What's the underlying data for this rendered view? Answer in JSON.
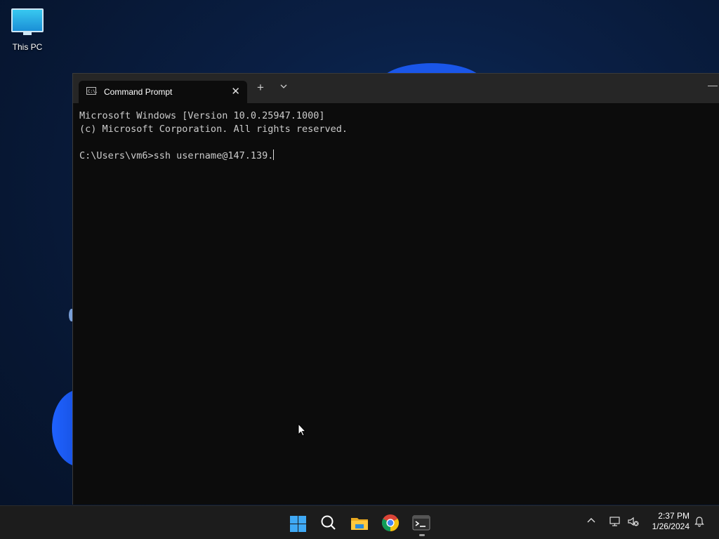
{
  "desktop": {
    "icons": [
      {
        "label": "This PC",
        "icon": "this-pc-icon"
      }
    ]
  },
  "terminal": {
    "tab_title": "Command Prompt",
    "tab_icon": "cmd-icon",
    "tab_icon_text": "C:\\.",
    "new_tab": "+",
    "dropdown": "⌄",
    "close": "✕",
    "minimize": "—",
    "lines": [
      "Microsoft Windows [Version 10.0.25947.1000]",
      "(c) Microsoft Corporation. All rights reserved.",
      "",
      "C:\\Users\\vm6>ssh username@147.139."
    ]
  },
  "taskbar": {
    "apps": [
      "start",
      "search",
      "file-explorer",
      "chrome",
      "terminal"
    ],
    "tray_chevron": "^",
    "time": "2:37 PM",
    "date": "1/26/2024"
  },
  "colors": {
    "accent": "#3fa9f5",
    "terminal_bg": "#0c0c0c",
    "titlebar_bg": "#262626",
    "taskbar_bg": "#1c1c1c"
  }
}
